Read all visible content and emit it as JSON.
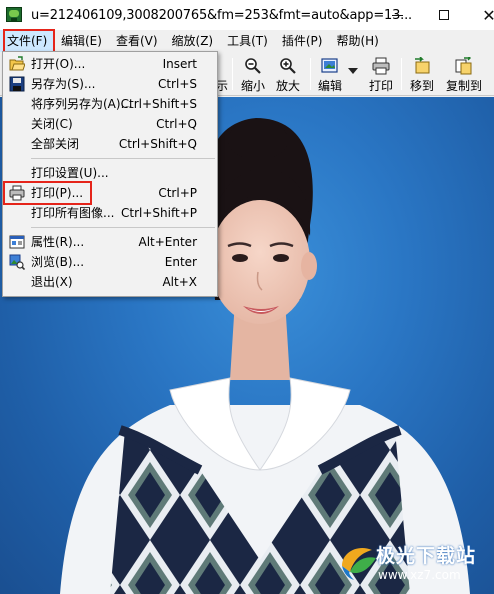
{
  "window": {
    "title": "u=212406109,3008200765&fm=253&fmt=auto&app=13...",
    "minimize_label": "",
    "maximize_label": "",
    "close_label": "✕"
  },
  "menubar": {
    "items": [
      {
        "label": "文件(F)"
      },
      {
        "label": "编辑(E)"
      },
      {
        "label": "查看(V)"
      },
      {
        "label": "缩放(Z)"
      },
      {
        "label": "工具(T)"
      },
      {
        "label": "插件(P)"
      },
      {
        "label": "帮助(H)"
      }
    ]
  },
  "toolbar": {
    "buttons": [
      {
        "label": "示",
        "icon": "partial-icon"
      },
      {
        "label": "缩小",
        "icon": "zoom-out-icon"
      },
      {
        "label": "放大",
        "icon": "zoom-in-icon"
      },
      {
        "label": "编辑",
        "icon": "edit-icon"
      },
      {
        "label": "打印",
        "icon": "printer-icon"
      },
      {
        "label": "移到",
        "icon": "move-to-icon"
      },
      {
        "label": "复制到",
        "icon": "copy-to-icon"
      }
    ]
  },
  "file_menu": {
    "items": [
      {
        "label": "打开(O)...",
        "shortcut": "Insert",
        "icon": "open-folder-icon"
      },
      {
        "label": "另存为(S)...",
        "shortcut": "Ctrl+S",
        "icon": "save-disk-icon"
      },
      {
        "label": "将序列另存为(A)...",
        "shortcut": "Ctrl+Shift+S",
        "icon": ""
      },
      {
        "label": "关闭(C)",
        "shortcut": "Ctrl+Q",
        "icon": ""
      },
      {
        "label": "全部关闭",
        "shortcut": "Ctrl+Shift+Q",
        "icon": ""
      },
      {
        "label": "打印设置(U)...",
        "shortcut": "",
        "icon": ""
      },
      {
        "label": "打印(P)...",
        "shortcut": "Ctrl+P",
        "icon": "printer-icon"
      },
      {
        "label": "打印所有图像...",
        "shortcut": "Ctrl+Shift+P",
        "icon": ""
      },
      {
        "label": "属性(R)...",
        "shortcut": "Alt+Enter",
        "icon": "properties-icon"
      },
      {
        "label": "浏览(B)...",
        "shortcut": "Enter",
        "icon": "browse-icon"
      },
      {
        "label": "退出(X)",
        "shortcut": "Alt+X",
        "icon": ""
      }
    ]
  },
  "watermark": {
    "line1": "极光下载站",
    "line2": "www.xz7.com"
  },
  "colors": {
    "accent_red": "#e5241a",
    "menu_highlight": "#cde8ff",
    "photo_background": "#2a76c4"
  }
}
